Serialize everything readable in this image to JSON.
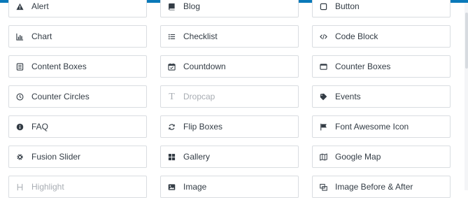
{
  "elements": [
    {
      "label": "Alert",
      "icon": "warning-icon",
      "disabled": false
    },
    {
      "label": "Blog",
      "icon": "book-icon",
      "disabled": false
    },
    {
      "label": "Button",
      "icon": "square-icon",
      "disabled": false
    },
    {
      "label": "Chart",
      "icon": "bar-chart-icon",
      "disabled": false
    },
    {
      "label": "Checklist",
      "icon": "list-icon",
      "disabled": false
    },
    {
      "label": "Code Block",
      "icon": "code-icon",
      "disabled": false
    },
    {
      "label": "Content Boxes",
      "icon": "content-boxes-icon",
      "disabled": false
    },
    {
      "label": "Countdown",
      "icon": "calendar-icon",
      "disabled": false
    },
    {
      "label": "Counter Boxes",
      "icon": "window-icon",
      "disabled": false
    },
    {
      "label": "Counter Circles",
      "icon": "clock-icon",
      "disabled": false
    },
    {
      "label": "Dropcap",
      "icon": "text-t-icon",
      "disabled": true
    },
    {
      "label": "Events",
      "icon": "ticket-icon",
      "disabled": false
    },
    {
      "label": "FAQ",
      "icon": "info-circle-icon",
      "disabled": false
    },
    {
      "label": "Flip Boxes",
      "icon": "sync-icon",
      "disabled": false
    },
    {
      "label": "Font Awesome Icon",
      "icon": "flag-icon",
      "disabled": false
    },
    {
      "label": "Fusion Slider",
      "icon": "gear-icon",
      "disabled": false
    },
    {
      "label": "Gallery",
      "icon": "grid-icon",
      "disabled": false
    },
    {
      "label": "Google Map",
      "icon": "map-icon",
      "disabled": false
    },
    {
      "label": "Highlight",
      "icon": "heading-icon",
      "disabled": true
    },
    {
      "label": "Image",
      "icon": "image-icon",
      "disabled": false
    },
    {
      "label": "Image Before & After",
      "icon": "before-after-icon",
      "disabled": false
    }
  ],
  "colors": {
    "accent": "#0a79b9",
    "text": "#333c45",
    "muted": "#a8adb3",
    "border": "#d9dde1"
  }
}
